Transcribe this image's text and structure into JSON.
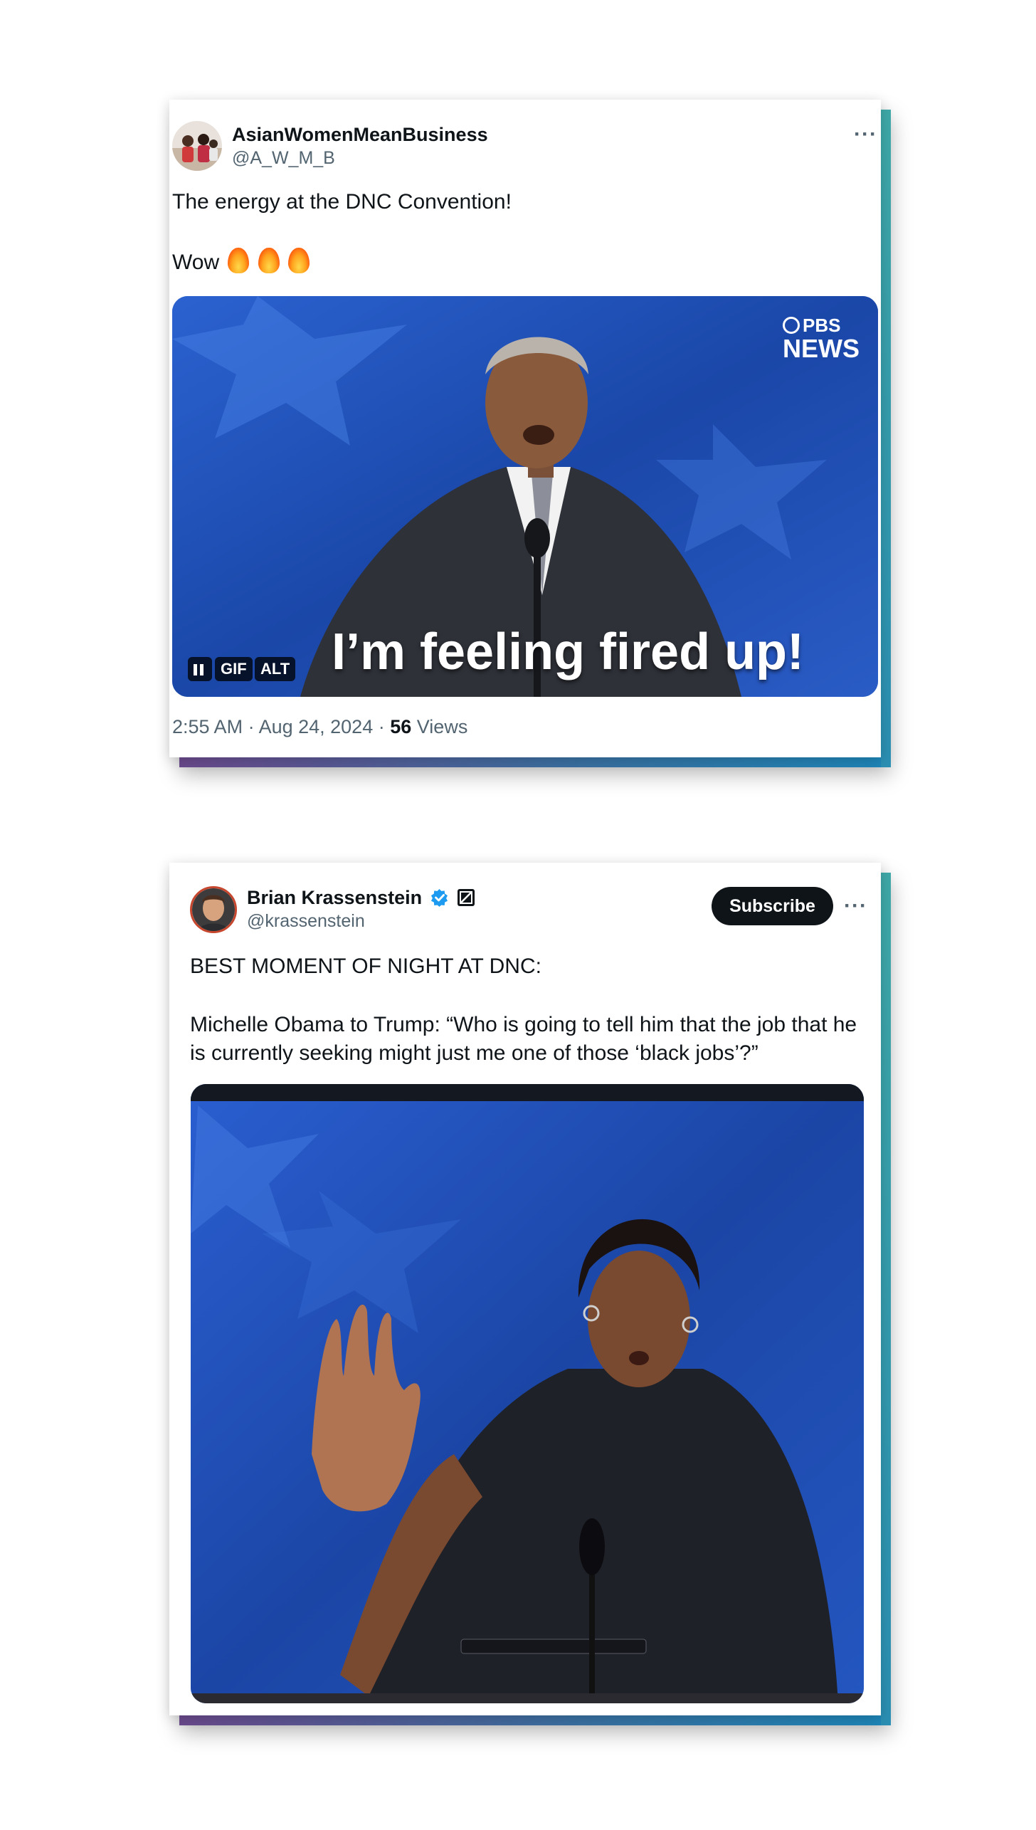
{
  "tweet1": {
    "author_name": "AsianWomenMeanBusiness",
    "author_handle": "@A_W_M_B",
    "more_label": "···",
    "line1": "The energy at the DNC Convention!",
    "line2": "Wow",
    "emoji_icons": [
      "fire-icon",
      "fire-icon",
      "fire-icon"
    ],
    "media": {
      "caption": "I’m feeling fired up!",
      "watermark_top": "PBS",
      "watermark_bottom": "NEWS",
      "gif_label": "GIF",
      "alt_label": "ALT"
    },
    "time": "2:55 AM · Aug 24, 2024 ·",
    "views_count": "56",
    "views_label": "Views"
  },
  "tweet2": {
    "author_name": "Brian Krassenstein",
    "author_handle": "@krassenstein",
    "subscribe_label": "Subscribe",
    "more_label": "···",
    "line1": "BEST MOMENT OF NIGHT AT DNC:",
    "line2": "Michelle Obama to Trump:  “Who is going to tell him that the job that he",
    "line3": "is currently seeking might just me one of those ‘black jobs’?”"
  },
  "colors": {
    "accent_verified": "#1d9bf0",
    "text_primary": "#0f1419",
    "text_secondary": "#536471",
    "media_stage_blue": "#1c4fb0"
  }
}
